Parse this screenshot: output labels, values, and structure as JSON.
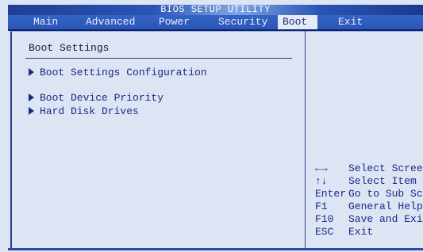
{
  "header": {
    "title": "BIOS SETUP UTILITY"
  },
  "tabs": [
    {
      "label": "Main"
    },
    {
      "label": "Advanced"
    },
    {
      "label": "Power"
    },
    {
      "label": "Security"
    },
    {
      "label": "Boot"
    },
    {
      "label": "Exit"
    }
  ],
  "active_tab": "Boot",
  "main": {
    "title": "Boot Settings",
    "items": [
      {
        "label": "Boot Settings Configuration"
      },
      {
        "label": "Boot Device Priority"
      },
      {
        "label": "Hard Disk Drives"
      }
    ]
  },
  "help": [
    {
      "key": "←→",
      "desc": "Select Screen"
    },
    {
      "key": "↑↓",
      "desc": "Select Item"
    },
    {
      "key": "Enter",
      "desc": "Go to Sub Screen"
    },
    {
      "key": "F1",
      "desc": "General Help"
    },
    {
      "key": "F10",
      "desc": "Save and Exit"
    },
    {
      "key": "ESC",
      "desc": "Exit"
    }
  ],
  "colors": {
    "background": "#dde4f4",
    "header_blue": "#2b55b5",
    "text_blue": "#1b2a86",
    "active_tab_bg": "#e5eaf7"
  }
}
